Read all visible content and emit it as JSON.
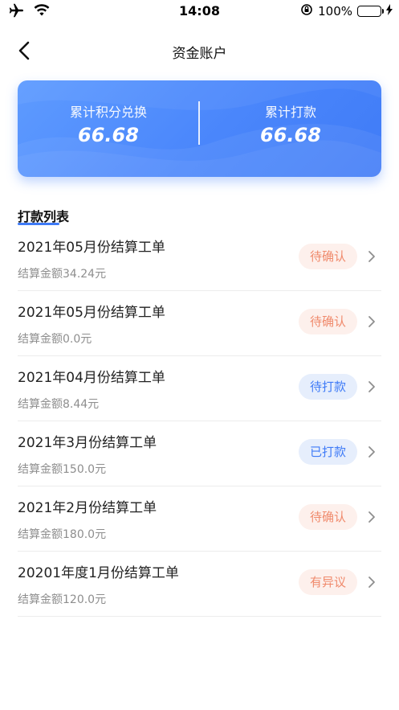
{
  "status_bar": {
    "time": "14:08",
    "battery_percent": "100%",
    "icons": [
      "airplane-icon",
      "wifi-icon",
      "orientation-lock-icon",
      "battery-icon",
      "charging-icon"
    ]
  },
  "nav": {
    "title": "资金账户",
    "back_icon": "chevron-left-icon"
  },
  "summary": {
    "left_label": "累计积分兑换",
    "left_value": "66.68",
    "right_label": "累计打款",
    "right_value": "66.68",
    "colors": {
      "card_start": "#5e9bff",
      "card_end": "#3f7bf7"
    }
  },
  "section": {
    "title": "打款列表"
  },
  "items": [
    {
      "name": "2021年05月份结算工单",
      "amount": "结算金额34.24元",
      "status": "待确认",
      "status_color": "orange"
    },
    {
      "name": "2021年05月份结算工单",
      "amount": "结算金额0.0元",
      "status": "待确认",
      "status_color": "orange"
    },
    {
      "name": "2021年04月份结算工单",
      "amount": "结算金额8.44元",
      "status": "待打款",
      "status_color": "blue"
    },
    {
      "name": "2021年3月份结算工单",
      "amount": "结算金额150.0元",
      "status": "已打款",
      "status_color": "blue"
    },
    {
      "name": "2021年2月份结算工单",
      "amount": "结算金额180.0元",
      "status": "待确认",
      "status_color": "orange"
    },
    {
      "name": "20201年度1月份结算工单",
      "amount": "结算金额120.0元",
      "status": "有异议",
      "status_color": "orange"
    }
  ]
}
